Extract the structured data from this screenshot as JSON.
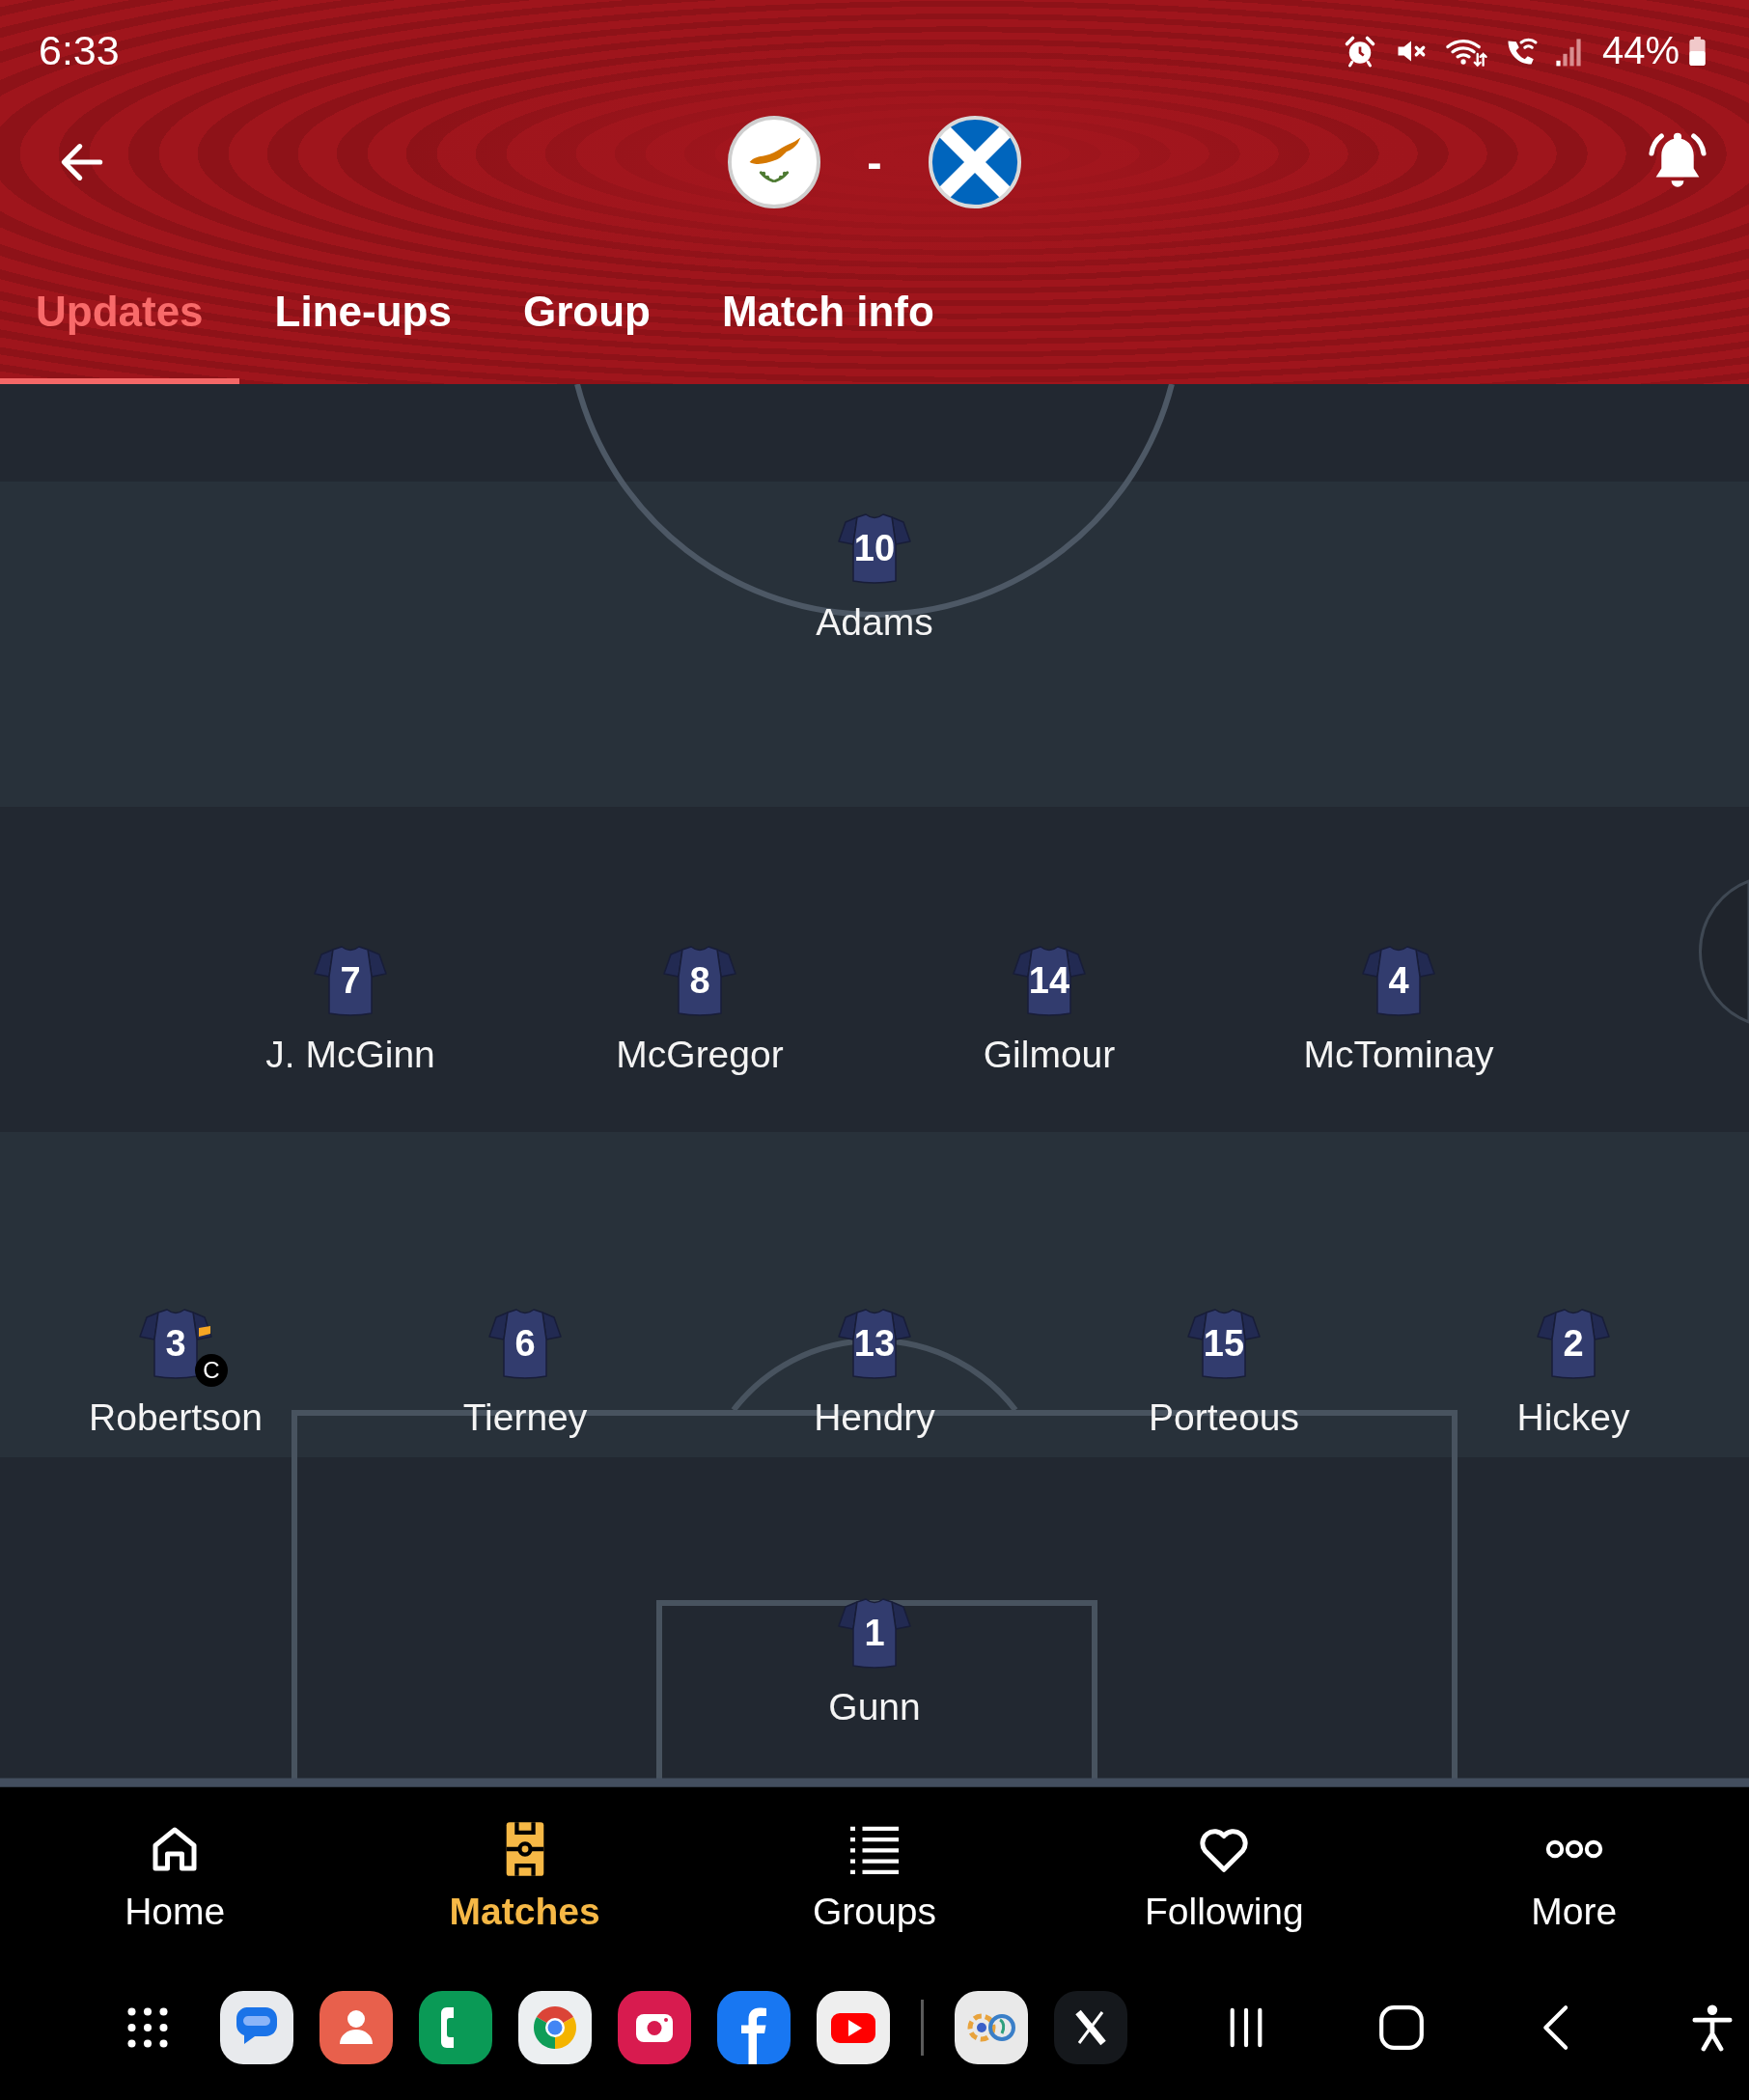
{
  "status_bar": {
    "time": "6:33",
    "battery": "44%"
  },
  "match": {
    "separator": "-"
  },
  "tabs": [
    {
      "label": "Updates",
      "selected": true
    },
    {
      "label": "Line-ups",
      "selected": false
    },
    {
      "label": "Group",
      "selected": false
    },
    {
      "label": "Match info",
      "selected": false
    }
  ],
  "lineup": {
    "captain_mark": "C",
    "rows": [
      {
        "players": [
          {
            "number": "10",
            "name": "Adams",
            "captain": false
          }
        ]
      },
      {
        "players": [
          {
            "number": "7",
            "name": "J. McGinn",
            "captain": false
          },
          {
            "number": "8",
            "name": "McGregor",
            "captain": false
          },
          {
            "number": "14",
            "name": "Gilmour",
            "captain": false
          },
          {
            "number": "4",
            "name": "McTominay",
            "captain": false
          }
        ]
      },
      {
        "players": [
          {
            "number": "3",
            "name": "Robertson",
            "captain": true
          },
          {
            "number": "6",
            "name": "Tierney",
            "captain": false
          },
          {
            "number": "13",
            "name": "Hendry",
            "captain": false
          },
          {
            "number": "15",
            "name": "Porteous",
            "captain": false
          },
          {
            "number": "2",
            "name": "Hickey",
            "captain": false
          }
        ]
      },
      {
        "players": [
          {
            "number": "1",
            "name": "Gunn",
            "captain": false
          }
        ]
      }
    ]
  },
  "bottom_nav": [
    {
      "label": "Home",
      "selected": false
    },
    {
      "label": "Matches",
      "selected": true
    },
    {
      "label": "Groups",
      "selected": false
    },
    {
      "label": "Following",
      "selected": false
    },
    {
      "label": "More",
      "selected": false
    }
  ]
}
